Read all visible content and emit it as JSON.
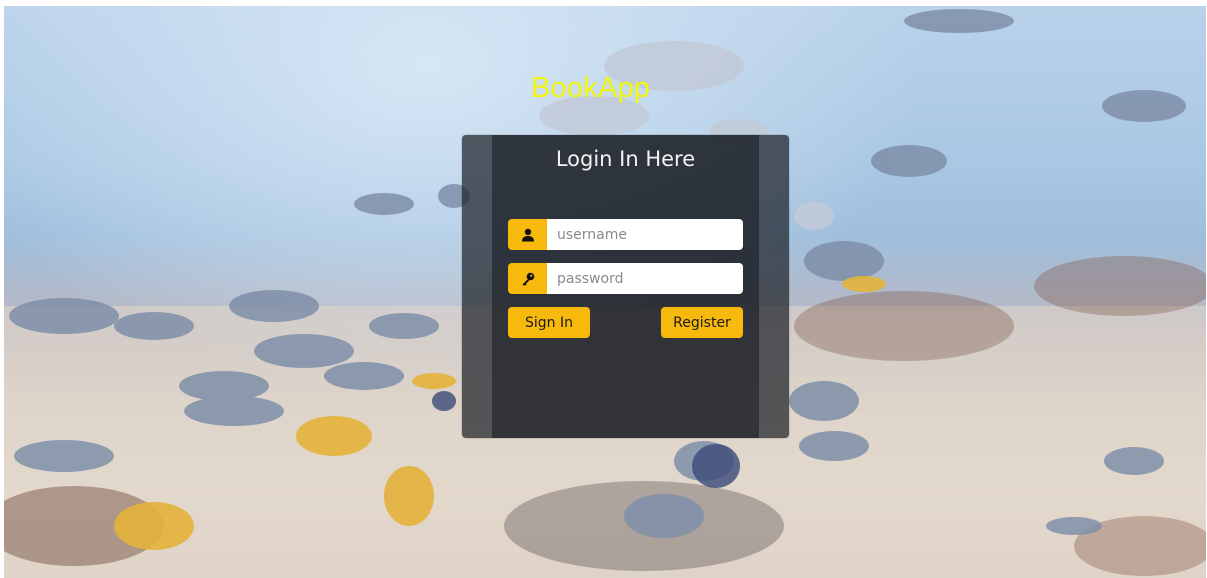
{
  "app": {
    "title": "BookApp"
  },
  "login": {
    "heading": "Login In Here",
    "username": {
      "placeholder": "username",
      "value": "",
      "icon": "user-icon"
    },
    "password": {
      "placeholder": "password",
      "value": "",
      "icon": "key-icon"
    },
    "sign_in_label": "Sign In",
    "register_label": "Register"
  },
  "colors": {
    "accent": "#f7b90c",
    "title": "#f4f70d",
    "panel": "#1e222a"
  }
}
